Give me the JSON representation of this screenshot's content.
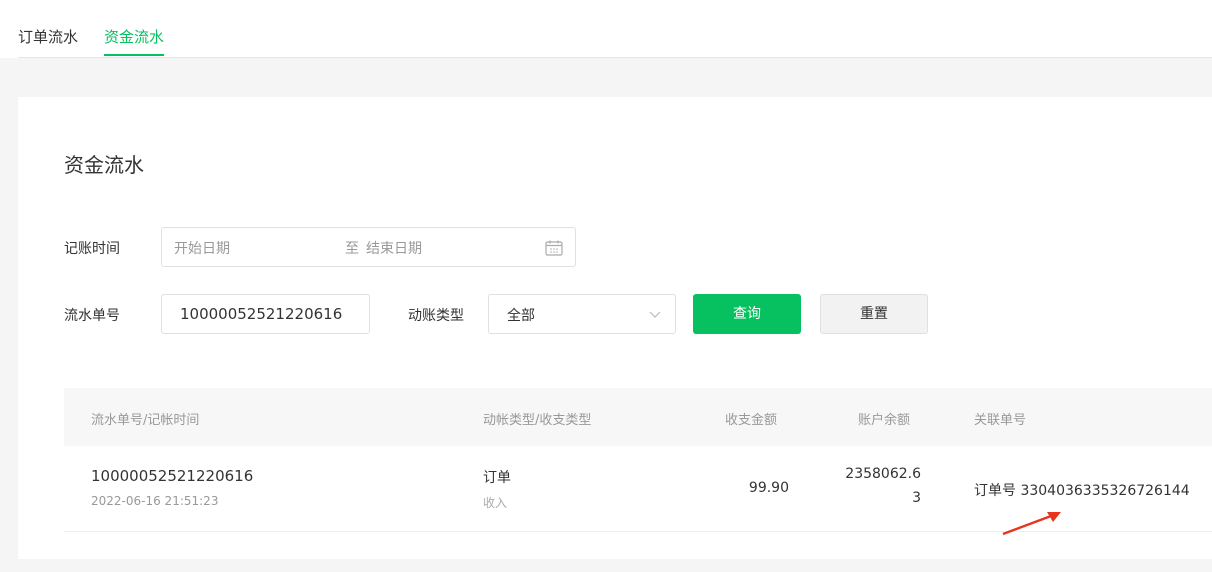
{
  "header": {
    "crumb_fragment": "",
    "tabs": [
      {
        "label": "订单流水",
        "active": false
      },
      {
        "label": "资金流水",
        "active": true
      }
    ]
  },
  "card": {
    "title": "资金流水"
  },
  "filters": {
    "time_label": "记账时间",
    "start_placeholder": "开始日期",
    "range_separator": "至",
    "end_placeholder": "结束日期",
    "serial_label": "流水单号",
    "serial_value": "10000052521220616",
    "type_label": "动账类型",
    "type_selected": "全部",
    "query_button": "查询",
    "reset_button": "重置"
  },
  "table": {
    "columns": [
      "流水单号/记帐时间",
      "动帐类型/收支类型",
      "收支金额",
      "账户余额",
      "关联单号"
    ],
    "rows": [
      {
        "serial": "10000052521220616",
        "time": "2022-06-16 21:51:23",
        "type": "订单",
        "direction": "收入",
        "amount": "99.90",
        "balance_line1": "2358062.6",
        "balance_line2": "3",
        "related": "订单号 3304036335326726144"
      }
    ]
  },
  "colors": {
    "accent": "#07c160",
    "arrow": "#e8341c"
  },
  "icons": [
    "calendar-icon",
    "chevron-down-icon",
    "arrow-annotation"
  ]
}
